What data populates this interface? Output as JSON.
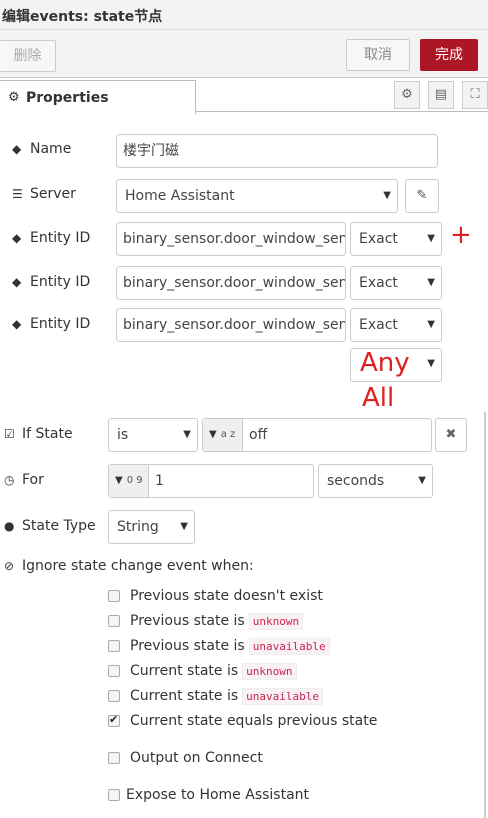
{
  "window": {
    "title": "编辑events: state节点"
  },
  "toolbar": {
    "delete_label": "删除",
    "cancel_label": "取消",
    "done_label": "完成"
  },
  "tabs": {
    "properties_label": "Properties"
  },
  "icons": {
    "tag": "tag-icon",
    "server": "server-icon",
    "gear": "gear-icon",
    "doc": "document-icon",
    "frame": "frame-icon",
    "pencil": "pencil-icon",
    "clock": "clock-icon",
    "drop": "drop-icon",
    "ban": "ban-icon",
    "check": "check-icon",
    "close": "close-icon"
  },
  "form": {
    "name": {
      "label": "Name",
      "value": "楼宇门磁"
    },
    "server": {
      "label": "Server",
      "value": "Home Assistant"
    },
    "entities": [
      {
        "label": "Entity ID",
        "value": "binary_sensor.door_window_sensor",
        "match": "Exact"
      },
      {
        "label": "Entity ID",
        "value": "binary_sensor.door_window_sensor",
        "match": "Exact"
      },
      {
        "label": "Entity ID",
        "value": "binary_sensor.door_window_sensor",
        "match": "Exact"
      }
    ],
    "annotation": {
      "plus": "+",
      "any": "Any",
      "all": "All"
    },
    "if_state": {
      "label": "If State",
      "operator": "is",
      "type_glyph": "a z",
      "value": "off"
    },
    "for": {
      "label": "For",
      "type_glyph": "0 9",
      "value": "1",
      "unit": "seconds"
    },
    "state_type": {
      "label": "State Type",
      "value": "String"
    },
    "ignore": {
      "label": "Ignore state change event when:",
      "options": [
        {
          "text": "Previous state doesn't exist",
          "code": "",
          "checked": false
        },
        {
          "text": "Previous state is",
          "code": "unknown",
          "checked": false
        },
        {
          "text": "Previous state is",
          "code": "unavailable",
          "checked": false
        },
        {
          "text": "Current state is",
          "code": "unknown",
          "checked": false
        },
        {
          "text": "Current state is",
          "code": "unavailable",
          "checked": false
        },
        {
          "text": "Current state equals previous state",
          "code": "",
          "checked": true
        }
      ]
    },
    "output_on_connect": {
      "label": "Output on Connect",
      "checked": false
    },
    "expose": {
      "label": "Expose to Home Assistant",
      "checked": false
    }
  },
  "colors": {
    "primary": "#ad1625",
    "annotation": "#e02020"
  }
}
